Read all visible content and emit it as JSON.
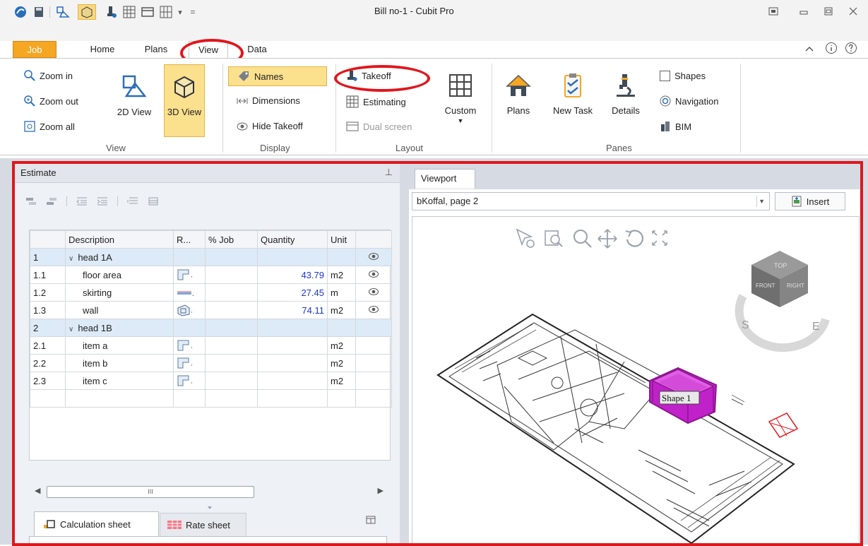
{
  "app": {
    "title": "Bill no-1 - Cubit Pro"
  },
  "quick_access": {
    "dropdown_glyph": "▾",
    "customize_glyph": "="
  },
  "tabs": [
    {
      "label": "Job"
    },
    {
      "label": "Home"
    },
    {
      "label": "Plans"
    },
    {
      "label": "View"
    },
    {
      "label": "Data"
    }
  ],
  "ribbon": {
    "view_group": {
      "label": "View",
      "zoom_in": "Zoom in",
      "zoom_out": "Zoom out",
      "zoom_all": "Zoom all",
      "view_2d": "2D View",
      "view_3d": "3D View"
    },
    "display_group": {
      "label": "Display",
      "names": "Names",
      "dimensions": "Dimensions",
      "hide_takeoff": "Hide Takeoff"
    },
    "layout_group": {
      "label": "Layout",
      "takeoff": "Takeoff",
      "estimating": "Estimating",
      "dual_screen": "Dual screen",
      "custom": "Custom"
    },
    "panes_group": {
      "label": "Panes",
      "plans": "Plans",
      "new_task": "New Task",
      "details": "Details",
      "shapes": "Shapes",
      "navigation": "Navigation",
      "bim": "BIM"
    }
  },
  "estimate": {
    "title": "Estimate",
    "pin_glyph": "⊥",
    "columns": [
      "Description",
      "R...",
      "% Job",
      "Quantity",
      "Unit"
    ],
    "rows": [
      {
        "num": "1",
        "desc": "head 1A",
        "qty": "",
        "unit": "",
        "head": true
      },
      {
        "num": "1.1",
        "desc": "floor area",
        "qty": "43.79",
        "unit": "m2",
        "head": false
      },
      {
        "num": "1.2",
        "desc": "skirting",
        "qty": "27.45",
        "unit": "m",
        "head": false
      },
      {
        "num": "1.3",
        "desc": "wall",
        "qty": "74.11",
        "unit": "m2",
        "head": false
      },
      {
        "num": "2",
        "desc": "head 1B",
        "qty": "",
        "unit": "",
        "head": true
      },
      {
        "num": "2.1",
        "desc": "item a",
        "qty": "",
        "unit": "m2",
        "head": false
      },
      {
        "num": "2.2",
        "desc": "item b",
        "qty": "",
        "unit": "m2",
        "head": false
      },
      {
        "num": "2.3",
        "desc": "item c",
        "qty": "",
        "unit": "m2",
        "head": false
      }
    ],
    "scroll_thumb": "III",
    "sheet_tabs": [
      {
        "label": "Calculation sheet"
      },
      {
        "label": "Rate sheet"
      }
    ]
  },
  "viewport": {
    "tab_label": "Viewport",
    "page_select": "bKoffal, page 2",
    "insert_label": "Insert",
    "shape_label": "Shape 1",
    "cube_faces": {
      "top": "TOP",
      "front": "FRONT",
      "right": "RIGHT"
    },
    "compass": {
      "s": "S",
      "e": "E"
    }
  },
  "colors": {
    "accent": "#f5a623",
    "highlight": "#fbe08d",
    "annotation_red": "#e0161d",
    "quantity_blue": "#1b35d6",
    "shape_magenta": "#c021c9"
  }
}
